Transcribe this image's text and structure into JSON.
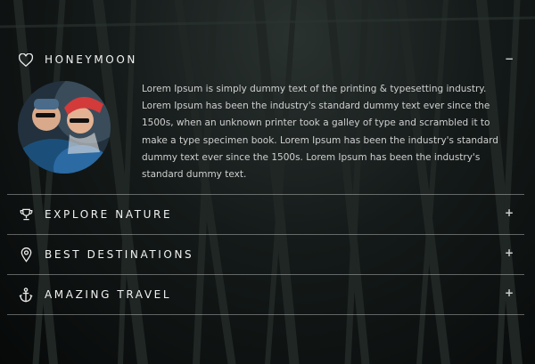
{
  "accordion": {
    "items": [
      {
        "title": "HONEYMOON",
        "icon": "heart-icon",
        "toggle": "−",
        "expanded": true,
        "body": "Lorem Ipsum is simply dummy text of the printing & typesetting industry. Lorem Ipsum has been the industry's standard dummy text ever since the 1500s, when an unknown printer took a galley of type and scrambled it to make a type specimen book. Lorem Ipsum has been the industry's standard dummy text ever since the 1500s. Lorem Ipsum has been the industry's standard dummy text."
      },
      {
        "title": "EXPLORE NATURE",
        "icon": "trophy-icon",
        "toggle": "+",
        "expanded": false
      },
      {
        "title": "BEST DESTINATIONS",
        "icon": "map-pin-icon",
        "toggle": "+",
        "expanded": false
      },
      {
        "title": "AMAZING TRAVEL",
        "icon": "anchor-icon",
        "toggle": "+",
        "expanded": false
      }
    ]
  },
  "colors": {
    "background": "#0b0f0e",
    "divider": "#6b6b6b",
    "text": "#d0d0d0"
  }
}
